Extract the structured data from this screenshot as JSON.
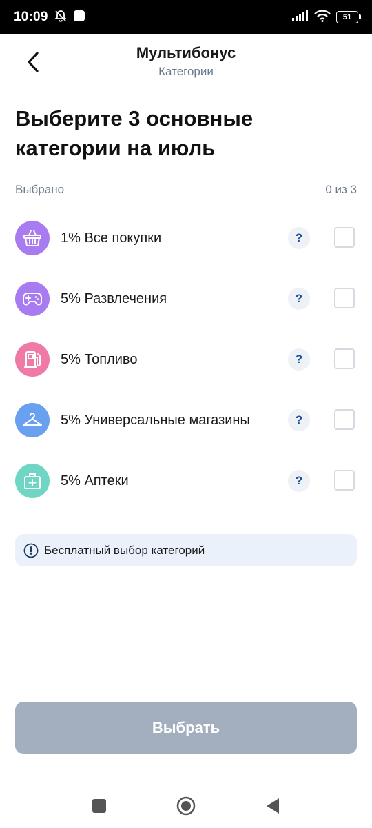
{
  "status": {
    "time": "10:09",
    "battery": "51"
  },
  "header": {
    "title": "Мультибонус",
    "subtitle": "Категории"
  },
  "heading": "Выберите 3 основные категории на июль",
  "selection": {
    "label": "Выбрано",
    "count": "0 из 3"
  },
  "categories": [
    {
      "label": "1% Все покупки",
      "icon": "basket-icon",
      "color": "#a87cf0",
      "checked": false,
      "help": "?"
    },
    {
      "label": "5% Развлечения",
      "icon": "gamepad-icon",
      "color": "#a87cf0",
      "checked": false,
      "help": "?"
    },
    {
      "label": "5% Топливо",
      "icon": "fuel-pump-icon",
      "color": "#f07aa6",
      "checked": false,
      "help": "?"
    },
    {
      "label": "5% Универсальные магазины",
      "icon": "hanger-icon",
      "color": "#6aa0f0",
      "checked": false,
      "help": "?"
    },
    {
      "label": "5% Аптеки",
      "icon": "first-aid-kit-icon",
      "color": "#6fd6c6",
      "checked": false,
      "help": "?"
    }
  ],
  "info": {
    "text": "Бесплатный выбор категорий",
    "icon": "info-icon"
  },
  "primary_button": {
    "label": "Выбрать",
    "enabled": false
  },
  "colors": {
    "accent_disabled": "#a3afbe",
    "banner_bg": "#eaf1fb",
    "help_text": "#1a4fa0"
  }
}
